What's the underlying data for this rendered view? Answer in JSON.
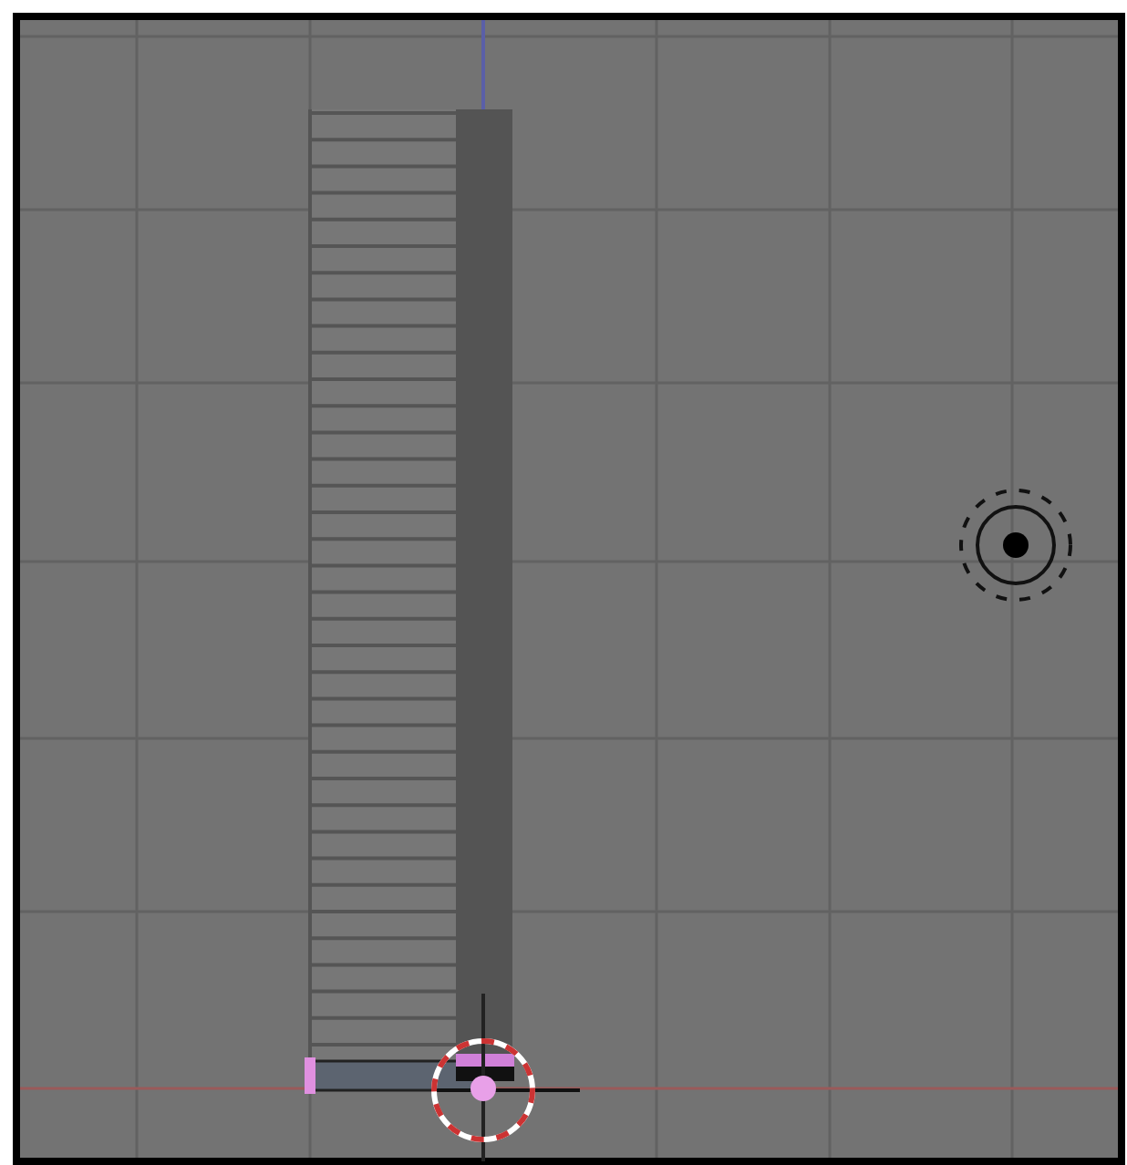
{
  "viewport": {
    "kind": "viewport3d"
  }
}
